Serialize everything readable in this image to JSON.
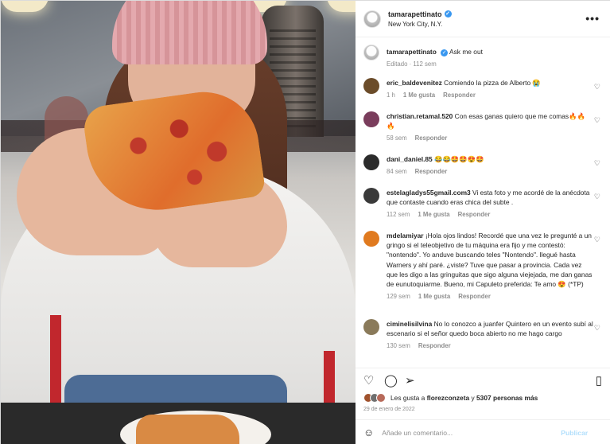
{
  "post": {
    "username": "tamarapettinato",
    "location": "New York City, N.Y."
  },
  "caption": {
    "username": "tamarapettinato",
    "text": "Ask me out",
    "edited": "Editado · 112 sem"
  },
  "comments": [
    {
      "user": "eric_baldevenitez",
      "text": "Comiendo la pizza de Alberto 😭",
      "time": "1 h",
      "likes": "1 Me gusta",
      "reply": "Responder",
      "avatar_color": "#6b4c2a"
    },
    {
      "user": "christian.retamal.520",
      "text": "Con esas ganas quiero que me comas🔥🔥🔥",
      "time": "58 sem",
      "likes": "",
      "reply": "Responder",
      "avatar_color": "#7a3d5c"
    },
    {
      "user": "dani_daniel.85",
      "text": "😂😂🤩🤩😍🤩",
      "time": "84 sem",
      "likes": "",
      "reply": "Responder",
      "avatar_color": "#2b2b2b"
    },
    {
      "user": "estelagladys55gmail.com3",
      "text": "Vi esta foto y me acordé de la anécdota que contaste cuando eras chica del subte .",
      "time": "112 sem",
      "likes": "1 Me gusta",
      "reply": "Responder",
      "avatar_color": "#3a3a3a"
    },
    {
      "user": "mdelamiyar",
      "text": "¡Hola ojos lindos! Recordé que una vez le pregunté a un gringo si el teleobjetivo de tu máquina era fijo y me contestó: \"nontendo\". Yo anduve buscando teles \"Nontendo\". llegué hasta Warners y ahí paré. ¿viste? Tuve que pasar a provincia. Cada vez que les digo a las gringuitas que sigo alguna viejejada, me dan ganas de eunutoquiarme. Bueno, mi Capuleto preferida: Te amo 😍 (*TP)",
      "time": "129 sem",
      "likes": "1 Me gusta",
      "reply": "Responder",
      "avatar_color": "#e07a1f"
    },
    {
      "user": "ciminelisilvina",
      "text": "No lo conozco a juanfer Quintero en un evento subí al escenario si el señor quedo boca abierto no me hago cargo",
      "time": "130 sem",
      "likes": "",
      "reply": "Responder",
      "avatar_color": "#8a7a5a"
    }
  ],
  "likes": {
    "prefix": "Les gusta a",
    "user": "florezconzeta",
    "middle": "y",
    "count": "5307 personas más"
  },
  "date": "29 de enero de 2022",
  "comment_box": {
    "placeholder": "Añade un comentario...",
    "publish": "Publicar"
  },
  "icons": {
    "more": "more-options-icon",
    "heart": "heart-icon",
    "comment": "comment-icon",
    "share": "share-icon",
    "save": "bookmark-icon",
    "emoji": "emoji-icon"
  },
  "colors": {
    "verified": "#3897f0",
    "muted": "#8e8e8e",
    "publish": "#b2dffc"
  }
}
